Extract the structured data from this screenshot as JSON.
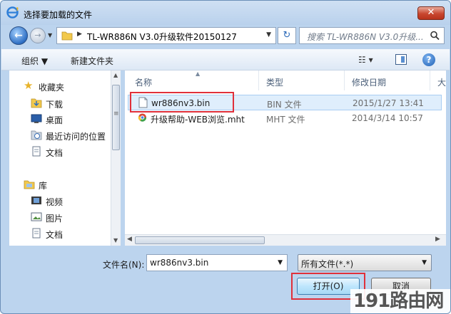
{
  "window": {
    "title": "选择要加载的文件",
    "close_label": "✕"
  },
  "nav": {
    "back": "←",
    "forward": "→"
  },
  "address": {
    "path": "TL-WR886N V3.0升级软件20150127"
  },
  "search": {
    "placeholder": "搜索 TL-WR886N V3.0升级..."
  },
  "toolbar": {
    "organize": "组织 ▼",
    "new_folder": "新建文件夹",
    "view": "☷ ▾",
    "help": "?"
  },
  "sidebar": {
    "favorites": "收藏夹",
    "items": [
      "下载",
      "桌面",
      "最近访问的位置",
      "文档"
    ],
    "library": "库",
    "lib_items": [
      "视频",
      "图片",
      "文档"
    ]
  },
  "columns": {
    "name": "名称",
    "type": "类型",
    "modified": "修改日期",
    "size": "大"
  },
  "files": [
    {
      "name": "wr886nv3.bin",
      "type": "BIN 文件",
      "date": "2015/1/27 13:41"
    },
    {
      "name": "升级帮助-WEB浏览.mht",
      "type": "MHT 文件",
      "date": "2014/3/14 10:57"
    }
  ],
  "filename": {
    "label": "文件名(N):",
    "value": "wr886nv3.bin"
  },
  "filetype": {
    "value": "所有文件(*.*)"
  },
  "buttons": {
    "open": "打开(O)",
    "cancel": "取消"
  },
  "watermark": "191路由网"
}
